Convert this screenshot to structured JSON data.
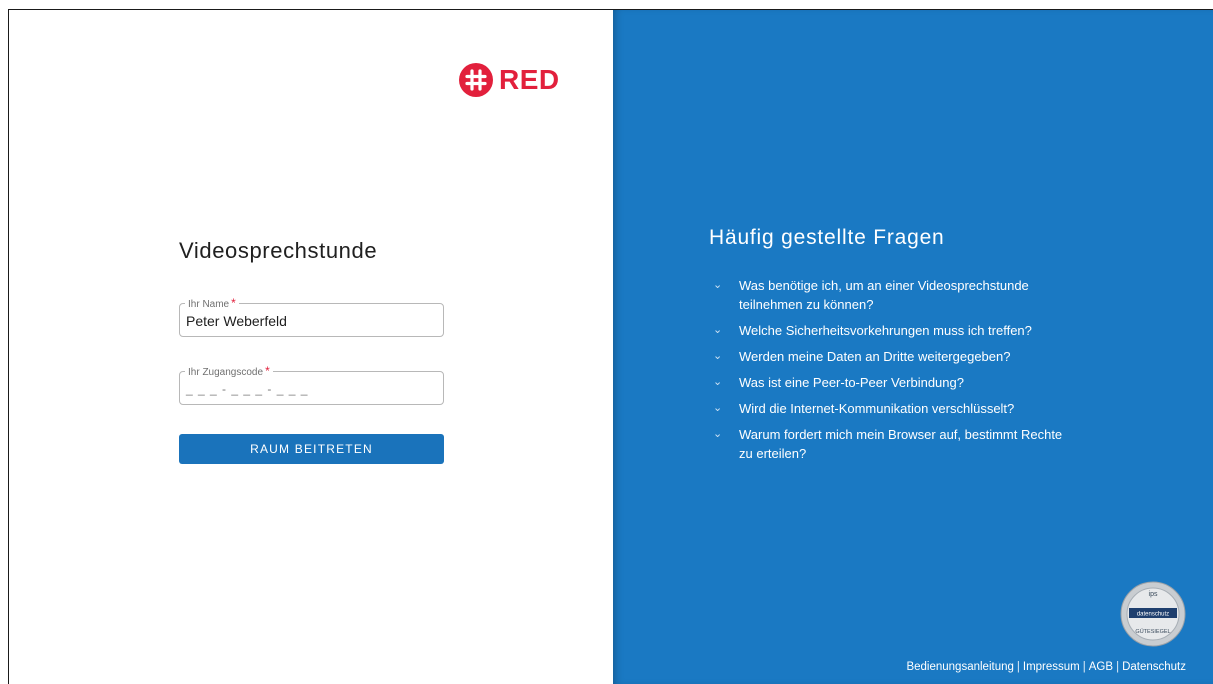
{
  "brand": {
    "name": "RED",
    "color": "#e2203c"
  },
  "login": {
    "title": "Videosprechstunde",
    "name_field": {
      "label": "Ihr Name",
      "required_mark": "*",
      "value": "Peter Weberfeld"
    },
    "code_field": {
      "label": "Ihr Zugangscode",
      "required_mark": "*",
      "mask": "_ _ _ - _ _ _ - _ _ _"
    },
    "join_button": "RAUM BEITRETEN"
  },
  "faq": {
    "title": "Häufig gestellte Fragen",
    "items": [
      "Was benötige ich, um an einer Videosprechstunde teilnehmen zu können?",
      "Welche Sicherheitsvorkehrungen muss ich treffen?",
      "Werden meine Daten an Dritte weitergegeben?",
      "Was ist eine Peer-to-Peer Verbindung?",
      "Wird die Internet-Kommunikation verschlüsselt?",
      "Warum fordert mich mein Browser auf, bestimmt Rechte zu erteilen?"
    ],
    "background": "#1a79c3"
  },
  "seal": {
    "top": "ips",
    "middle": "datenschutz",
    "bottom": "GÜTESIEGEL"
  },
  "footer": {
    "links": [
      "Bedienungsanleitung",
      "Impressum",
      "AGB",
      "Datenschutz"
    ],
    "separator": "|"
  }
}
